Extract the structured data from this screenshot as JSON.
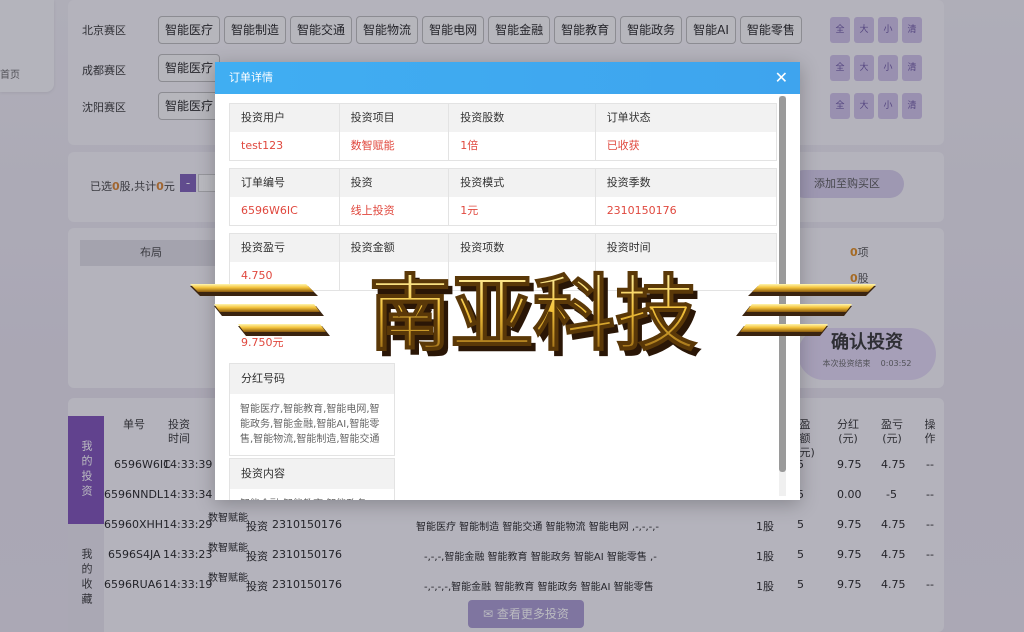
{
  "sidebar": {
    "fragment": "首页"
  },
  "regions": [
    {
      "name": "北京赛区"
    },
    {
      "name": "成都赛区"
    },
    {
      "name": "沈阳赛区"
    }
  ],
  "tags": [
    "智能医疗",
    "智能制造",
    "智能交通",
    "智能物流",
    "智能电网",
    "智能金融",
    "智能教育",
    "智能政务",
    "智能AI",
    "智能零售"
  ],
  "mini_buttons": [
    "全",
    "大",
    "小",
    "清"
  ],
  "cart": {
    "selected_prefix": "已选",
    "selected_count": "0",
    "selected_mid": "股,共计",
    "selected_amount": "0",
    "selected_suffix": "元",
    "minus": "-",
    "add_label": "添加至购买区"
  },
  "summary": {
    "layout_label": "布局",
    "items_count": "0",
    "items_unit": "项",
    "shares_count": "0",
    "shares_unit": "股",
    "confirm_label": "确认投资",
    "countdown_label": "本次投资结束",
    "countdown": "0:03:52"
  },
  "orders_panel": {
    "tab_mine": "我的投资",
    "tab_fav": "我的收藏",
    "headers": [
      "单号",
      "投资时间",
      "盈额(元)",
      "分红(元)",
      "盈亏(元)",
      "操作"
    ],
    "rows": [
      {
        "id": "6596W6IC",
        "time": "14:33:39",
        "amount": "5",
        "dividend": "9.75",
        "pnl": "4.75",
        "op": "--"
      },
      {
        "id": "6596NNDL",
        "time": "14:33:34",
        "amount": "5",
        "dividend": "0.00",
        "pnl": "-5",
        "op": "--"
      },
      {
        "id": "65960XHH",
        "time": "14:33:29",
        "project": "数智赋能",
        "type": "投资",
        "period": "2310150176",
        "numbers": "智能医疗 智能制造 智能交通 智能物流 智能电网 ,-,-,-,-",
        "qty": "1股",
        "amount": "5",
        "dividend": "9.75",
        "pnl": "4.75",
        "op": "--"
      },
      {
        "id": "6596S4JA",
        "time": "14:33:23",
        "project": "数智赋能",
        "type": "投资",
        "period": "2310150176",
        "numbers": "-,-,-,智能金融 智能教育 智能政务 智能AI 智能零售 ,-",
        "qty": "1股",
        "amount": "5",
        "dividend": "9.75",
        "pnl": "4.75",
        "op": "--"
      },
      {
        "id": "6596RUA6",
        "time": "14:33:19",
        "project": "数智赋能",
        "type": "投资",
        "period": "2310150176",
        "numbers": "-,-,-,-,智能金融 智能教育 智能政务 智能AI 智能零售",
        "qty": "1股",
        "amount": "5",
        "dividend": "9.75",
        "pnl": "4.75",
        "op": "--"
      }
    ],
    "more_label": "查看更多投资"
  },
  "modal": {
    "title": "订单详情",
    "close": "✕",
    "section1": {
      "headers": [
        "投资用户",
        "投资项目",
        "投资股数",
        "订单状态"
      ],
      "values": [
        "test123",
        "数智赋能",
        "1倍",
        "已收获"
      ]
    },
    "section2": {
      "headers": [
        "订单编号",
        "投资",
        "投资模式",
        "投资季数"
      ],
      "values": [
        "6596W6IC",
        "线上投资",
        "1元",
        "2310150176"
      ]
    },
    "section3": {
      "headers": [
        "投资盈亏",
        "投资金额",
        "投资项数",
        "投资时间"
      ],
      "values": [
        "4.750",
        "",
        "",
        ""
      ]
    },
    "extra_value": "9.750元",
    "dividend_box": {
      "title": "分红号码",
      "body": "智能医疗,智能教育,智能电网,智能政务,智能金融,智能AI,智能零售,智能物流,智能制造,智能交通"
    },
    "content_box": {
      "title": "投资内容",
      "body": "智能金融,智能教育,智能政务"
    }
  },
  "watermark": {
    "text": "南亚科技"
  },
  "colors": {
    "accent": "#7c4fb5",
    "modal_header": "#40aef2",
    "red_value": "#e0483e",
    "orange": "#e08a1a"
  }
}
